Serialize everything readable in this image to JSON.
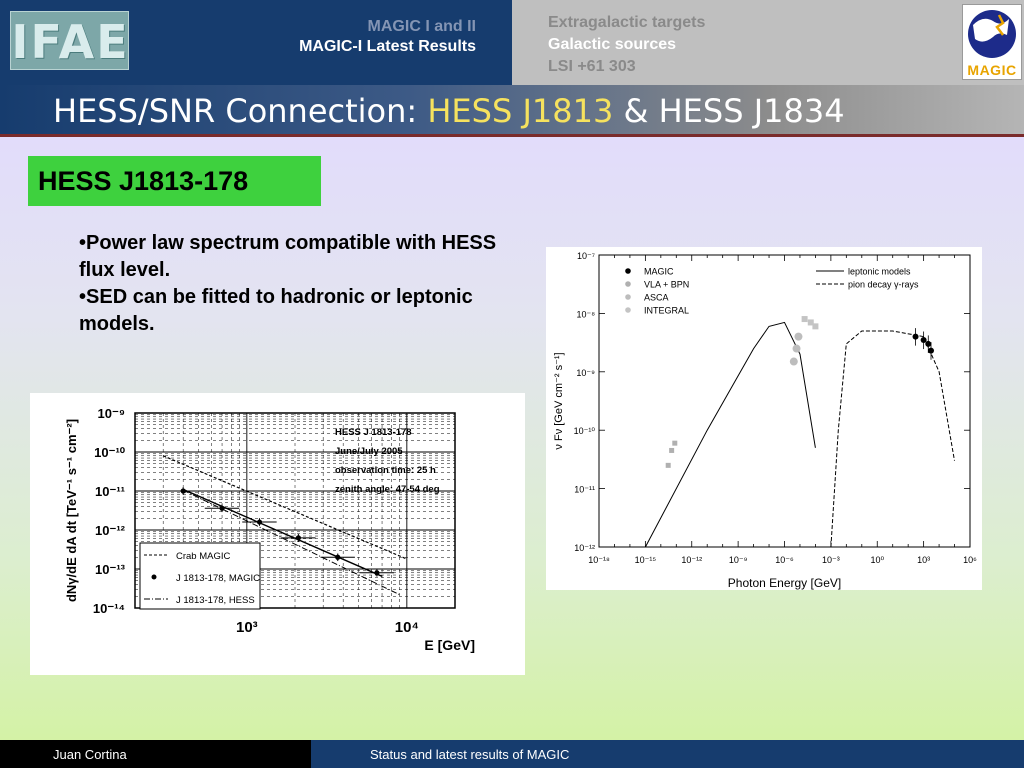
{
  "header": {
    "logo_left": "IFAE",
    "nav_left": [
      "MAGIC I and II",
      "MAGIC-I Latest Results"
    ],
    "nav_right": [
      "Extragalactic targets",
      "Galactic sources",
      "LSI +61 303"
    ],
    "logo_right": "MAGIC"
  },
  "slide": {
    "title_part1": "HESS/SNR Connection: ",
    "title_part2": "HESS J1813",
    "title_part3": " & HESS J1834",
    "section_label": "HESS J1813-178",
    "bullets": [
      "Power law spectrum compatible with HESS flux level.",
      "SED can be fitted to hadronic or leptonic models."
    ]
  },
  "footer": {
    "author": "Juan Cortina",
    "talk": "Status and latest results of MAGIC"
  },
  "colors": {
    "navy": "#163c6e",
    "section_green": "#3ed13e",
    "title_highlight": "#f6e25e"
  },
  "chart_data": [
    {
      "type": "line",
      "title": "",
      "xlabel": "E [GeV]",
      "ylabel": "dNγ/dE dA dt [TeV⁻¹ s⁻¹ cm⁻²]",
      "xscale": "log",
      "yscale": "log",
      "xlim": [
        200,
        20000
      ],
      "ylim": [
        1e-14,
        1e-09
      ],
      "x_tick_labels": [
        "10³",
        "10⁴"
      ],
      "y_tick_labels": [
        "10⁻⁹",
        "10⁻¹⁰",
        "10⁻¹¹",
        "10⁻¹²",
        "10⁻¹³",
        "10⁻¹⁴"
      ],
      "annotations": [
        "HESS J 1813-178",
        "June/July 2005",
        "observation time: 25 h",
        "zenith angle: 47-54 deg"
      ],
      "grid": true,
      "legend_position": "bottom-left",
      "series": [
        {
          "name": "Crab MAGIC",
          "style": "dashed",
          "x": [
            300,
            10000
          ],
          "y": [
            8e-11,
            1.8e-13
          ]
        },
        {
          "name": "J 1813-178, MAGIC",
          "style": "markers-with-fit",
          "x": [
            400,
            700,
            1200,
            2100,
            3700,
            6500
          ],
          "y": [
            1e-11,
            3.6e-12,
            1.6e-12,
            6.3e-13,
            2e-13,
            8e-14
          ]
        },
        {
          "name": "J 1813-178, HESS",
          "style": "dash-dot",
          "x": [
            400,
            9000
          ],
          "y": [
            1.05e-11,
            2.2e-14
          ]
        }
      ]
    },
    {
      "type": "scatter",
      "title": "",
      "xlabel": "Photon Energy [GeV]",
      "ylabel": "ν Fν [GeV cm⁻² s⁻¹]",
      "xscale": "log",
      "yscale": "log",
      "xlim": [
        1e-18,
        1000000.0
      ],
      "ylim": [
        1e-12,
        1e-07
      ],
      "x_tick_labels": [
        "10⁻¹⁸",
        "10⁻¹⁵",
        "10⁻¹²",
        "10⁻⁹",
        "10⁻⁶",
        "10⁻³",
        "10⁰",
        "10³",
        "10⁶"
      ],
      "y_tick_labels": [
        "10⁻⁷",
        "10⁻⁸",
        "10⁻⁹",
        "10⁻¹⁰",
        "10⁻¹¹",
        "10⁻¹²"
      ],
      "grid": false,
      "legend_position": "top",
      "series": [
        {
          "name": "MAGIC",
          "style": "black-dots",
          "x": [
            300,
            1000,
            2000,
            3000
          ],
          "y": [
            4e-09,
            3.5e-09,
            3e-09,
            2.3e-09
          ]
        },
        {
          "name": "VLA + BPN",
          "style": "gray-dots",
          "x": [
            3e-14,
            5e-14,
            8e-14
          ],
          "y": [
            2.5e-11,
            4.5e-11,
            6e-11
          ]
        },
        {
          "name": "ASCA",
          "style": "gray-band",
          "x": [
            4e-06,
            6e-06,
            8e-06
          ],
          "y": [
            1.5e-09,
            2.5e-09,
            4e-09
          ]
        },
        {
          "name": "INTEGRAL",
          "style": "gray-squares",
          "x": [
            2e-05,
            5e-05,
            0.0001
          ],
          "y": [
            8e-09,
            7e-09,
            6e-09
          ]
        },
        {
          "name": "leptonic models",
          "style": "solid",
          "x": [
            1e-15,
            1e-11,
            1e-08,
            1e-07,
            1e-06,
            1e-05,
            0.0001
          ],
          "y": [
            1e-12,
            1e-10,
            2.5e-09,
            6e-09,
            7e-09,
            2e-09,
            5e-11
          ]
        },
        {
          "name": "pion decay γ-rays",
          "style": "dashed",
          "x": [
            0.001,
            0.003,
            0.01,
            0.1,
            10,
            1000,
            10000,
            100000
          ],
          "y": [
            1e-12,
            1e-10,
            3e-09,
            5e-09,
            5e-09,
            4e-09,
            1e-09,
            3e-11
          ]
        }
      ]
    }
  ]
}
